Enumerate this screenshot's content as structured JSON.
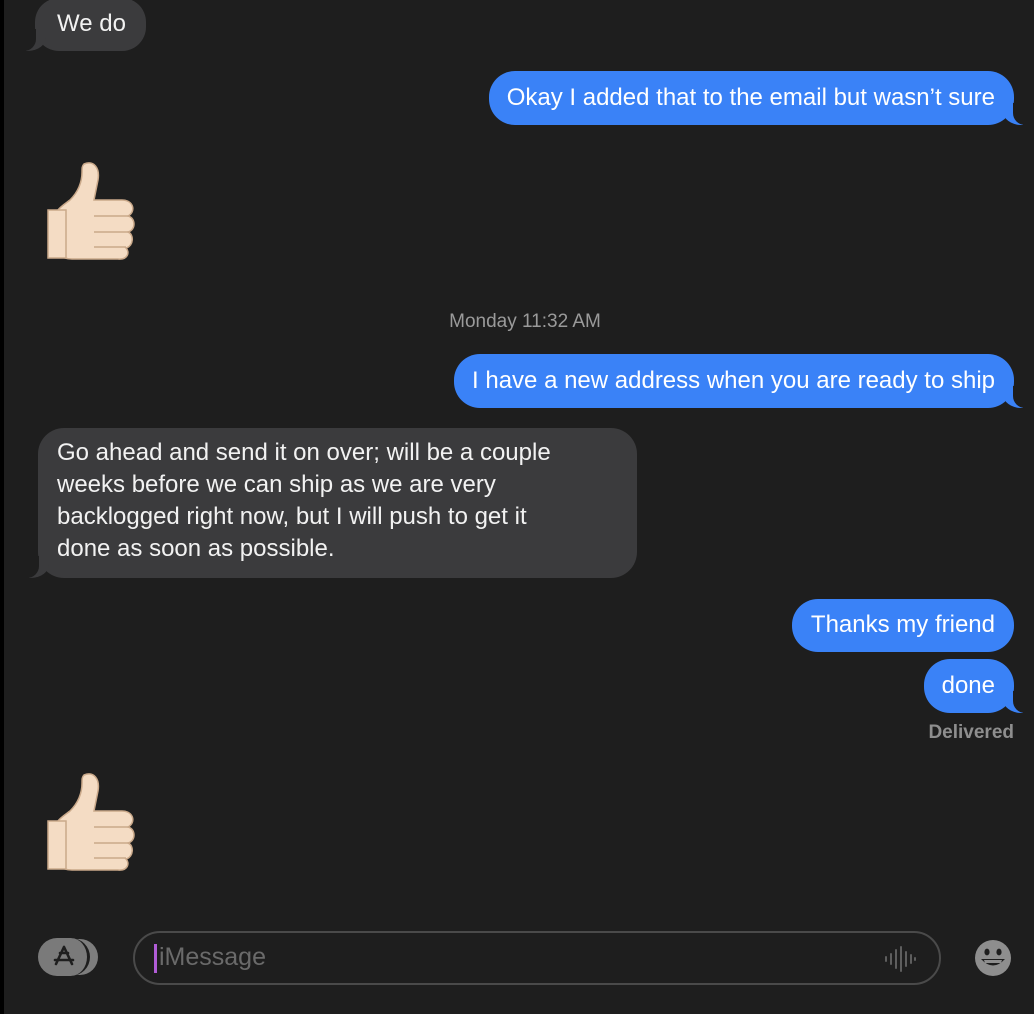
{
  "conversation": {
    "messages": [
      {
        "direction": "incoming",
        "text": "We do"
      },
      {
        "direction": "outgoing",
        "text": "Okay I added that to the email but wasn’t sure"
      },
      {
        "direction": "incoming",
        "reaction": "thumbs-up-emoji"
      },
      {
        "direction": "outgoing",
        "text": "I have a new address when you are ready to ship"
      },
      {
        "direction": "incoming",
        "lines": [
          "Go ahead and send it on over; will be a couple",
          "weeks before we can ship as we are very",
          "backlogged right now, but I will push to get it",
          "done as soon as possible."
        ]
      },
      {
        "direction": "outgoing",
        "text": "Thanks my friend"
      },
      {
        "direction": "outgoing",
        "text": "done"
      },
      {
        "direction": "incoming",
        "reaction": "thumbs-up-emoji"
      }
    ],
    "timestamp": "Monday 11:32 AM",
    "delivery_status": "Delivered"
  },
  "composer": {
    "placeholder": "iMessage",
    "apps_icon": "app-store-icon",
    "audio_icon": "audio-waveform-icon",
    "emoji_icon": "smiley-face-icon"
  },
  "colors": {
    "background": "#1e1e1e",
    "incoming_bubble": "#3b3b3d",
    "outgoing_bubble": "#3a82f7",
    "caret": "#b05cd6"
  }
}
